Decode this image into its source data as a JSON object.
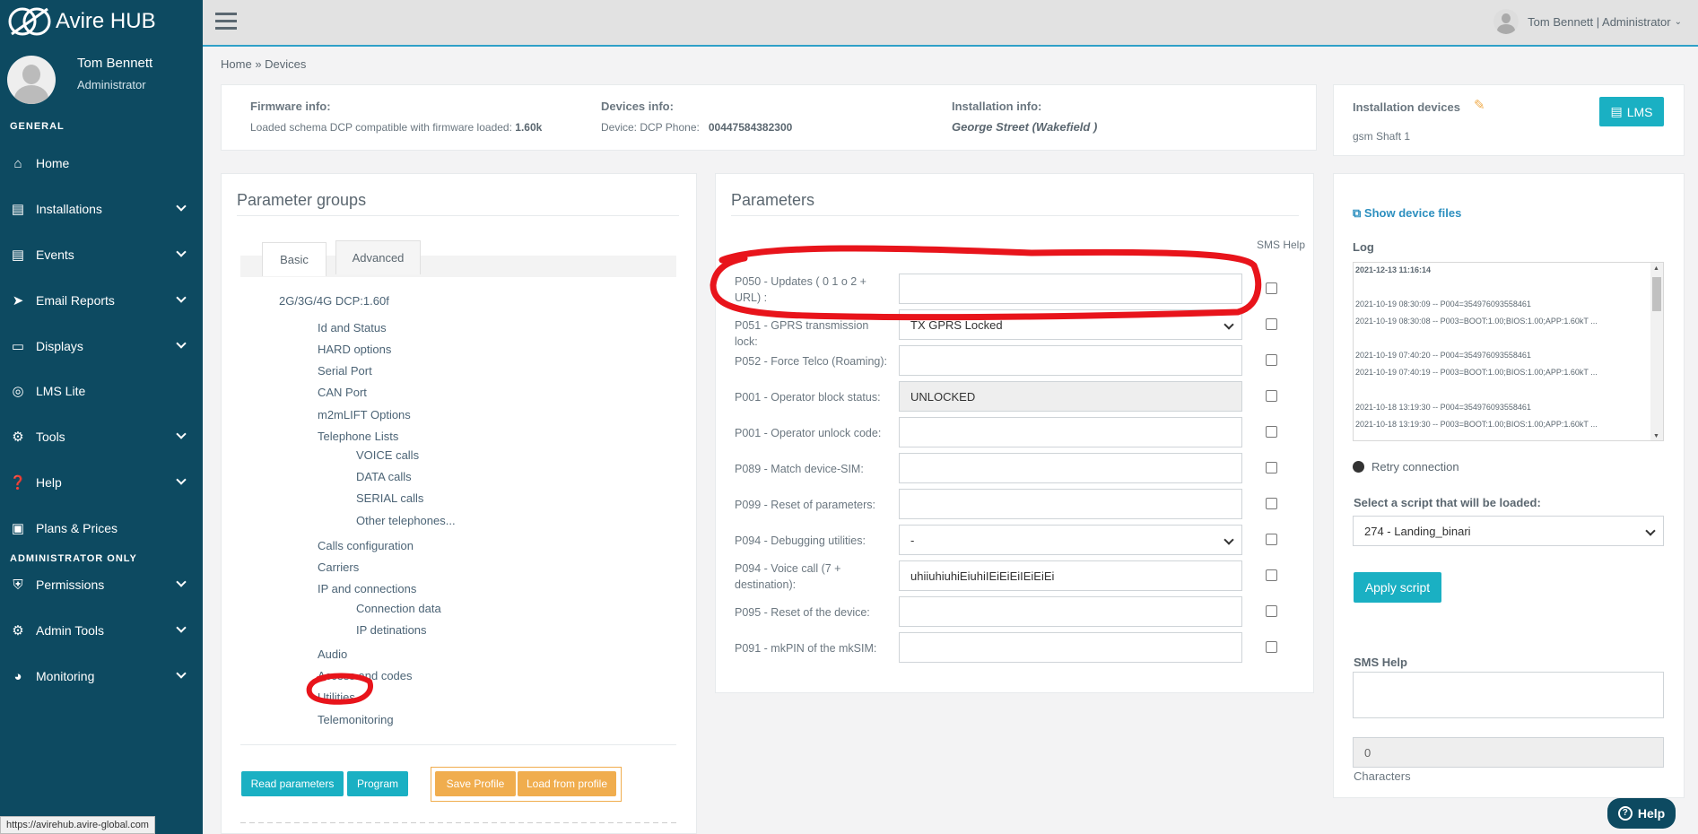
{
  "app": {
    "name": "Avire HUB"
  },
  "user": {
    "name": "Tom Bennett",
    "role": "Administrator",
    "top_label": "Tom Bennett | Administrator"
  },
  "sidebar": {
    "section_general": "GENERAL",
    "section_admin": "ADMINISTRATOR ONLY",
    "items": [
      {
        "label": "Home",
        "icon": "home-icon"
      },
      {
        "label": "Installations",
        "icon": "building-icon"
      },
      {
        "label": "Events",
        "icon": "document-icon"
      },
      {
        "label": "Email Reports",
        "icon": "paper-plane-icon"
      },
      {
        "label": "Displays",
        "icon": "monitor-icon"
      },
      {
        "label": "LMS Lite",
        "icon": "globe-icon"
      },
      {
        "label": "Tools",
        "icon": "cogs-icon"
      },
      {
        "label": "Help",
        "icon": "question-icon"
      },
      {
        "label": "Plans & Prices",
        "icon": "briefcase-icon"
      },
      {
        "label": "Permissions",
        "icon": "shield-icon"
      },
      {
        "label": "Admin Tools",
        "icon": "gear-icon"
      },
      {
        "label": "Monitoring",
        "icon": "dashboard-icon"
      }
    ]
  },
  "breadcrumb": {
    "home": "Home",
    "sep": "»",
    "current": "Devices"
  },
  "info": {
    "firmware_title": "Firmware info:",
    "firmware_text": "Loaded schema DCP compatible with firmware loaded:",
    "firmware_version": "1.60k",
    "devices_title": "Devices info:",
    "devices_text": "Device: DCP Phone:",
    "devices_phone": "00447584382300",
    "installation_title": "Installation info:",
    "installation_name": "George Street (Wakefield )"
  },
  "installation_devices": {
    "title": "Installation devices",
    "device": "gsm  Shaft 1",
    "lms_button": "LMS"
  },
  "parameter_groups": {
    "title": "Parameter groups",
    "tabs": [
      "Basic",
      "Advanced"
    ],
    "root": "2G/3G/4G DCP:1.60f",
    "tree": [
      {
        "label": "Id and Status",
        "level": 1
      },
      {
        "label": "HARD options",
        "level": 1
      },
      {
        "label": "Serial Port",
        "level": 1
      },
      {
        "label": "CAN Port",
        "level": 1
      },
      {
        "label": "m2mLIFT Options",
        "level": 1
      },
      {
        "label": "Telephone Lists",
        "level": 1
      },
      {
        "label": "VOICE calls",
        "level": 2
      },
      {
        "label": "DATA calls",
        "level": 2
      },
      {
        "label": "SERIAL calls",
        "level": 2
      },
      {
        "label": "Other telephones...",
        "level": 2
      },
      {
        "label": "Calls configuration",
        "level": 1
      },
      {
        "label": "Carriers",
        "level": 1
      },
      {
        "label": "IP and connections",
        "level": 1
      },
      {
        "label": "Connection data",
        "level": 2
      },
      {
        "label": "IP detinations",
        "level": 2
      },
      {
        "label": "Audio",
        "level": 1
      },
      {
        "label": "Access and codes",
        "level": 1
      },
      {
        "label": "Utilities",
        "level": 1
      },
      {
        "label": "Telemonitoring",
        "level": 1
      }
    ],
    "buttons": {
      "read": "Read parameters",
      "program": "Program",
      "save_profile": "Save Profile",
      "load_profile": "Load from profile"
    }
  },
  "parameters": {
    "title": "Parameters",
    "sms_help_header": "SMS Help",
    "rows": [
      {
        "label": "P050 - Updates ( 0 1 o 2 + URL) :",
        "value": "",
        "type": "text"
      },
      {
        "label": "P051 - GPRS transmission lock:",
        "value": "TX GPRS Locked",
        "type": "select"
      },
      {
        "label": "P052 - Force Telco (Roaming):",
        "value": "",
        "type": "text"
      },
      {
        "label": "P001 - Operator block status:",
        "value": "UNLOCKED",
        "type": "disabled"
      },
      {
        "label": "P001 - Operator unlock code:",
        "value": "",
        "type": "text"
      },
      {
        "label": "P089 - Match device-SIM:",
        "value": "",
        "type": "text"
      },
      {
        "label": "P099 - Reset of parameters:",
        "value": "",
        "type": "text"
      },
      {
        "label": "P094 - Debugging utilities:",
        "value": "-",
        "type": "select"
      },
      {
        "label": "P094 - Voice call (7 + destination):",
        "value": "uhiiuhiuhiEiuhiIEiEiEiIEiEiEi",
        "type": "text"
      },
      {
        "label": "P095 - Reset of the device:",
        "value": "",
        "type": "text"
      },
      {
        "label": "P091 - mkPIN of the mkSIM:",
        "value": "",
        "type": "text"
      }
    ]
  },
  "right_panel": {
    "show_files": "Show device files",
    "log_title": "Log",
    "log_lines": [
      {
        "text": "2021-12-13 11:16:14",
        "bold": true
      },
      {
        "text": "2021-10-19 08:30:09 -- P004=354976093558461",
        "bold": false
      },
      {
        "text": "2021-10-19 08:30:08 -- P003=BOOT:1.00;BIOS:1.00;APP:1.60kT ...",
        "bold": false
      },
      {
        "text": "2021-10-19 07:40:20 -- P004=354976093558461",
        "bold": false
      },
      {
        "text": "2021-10-19 07:40:19 -- P003=BOOT:1.00;BIOS:1.00;APP:1.60kT ...",
        "bold": false
      },
      {
        "text": "2021-10-18 13:19:30 -- P004=354976093558461",
        "bold": false
      },
      {
        "text": "2021-10-18 13:19:30 -- P003=BOOT:1.00;BIOS:1.00;APP:1.60kT ...",
        "bold": false
      }
    ],
    "retry": "Retry connection",
    "script_label": "Select a script that will be loaded:",
    "script_value": "274 - Landing_binari",
    "apply_button": "Apply script",
    "sms_help_title": "SMS Help",
    "char_count": "0",
    "characters_label": "Characters"
  },
  "help_button": "Help",
  "status_url": "https://avirehub.avire-global.com",
  "colors": {
    "sidebar": "#0d4a61",
    "accent": "#1ab0c3",
    "orange": "#f0ad4e",
    "annotation": "#e8141b"
  }
}
